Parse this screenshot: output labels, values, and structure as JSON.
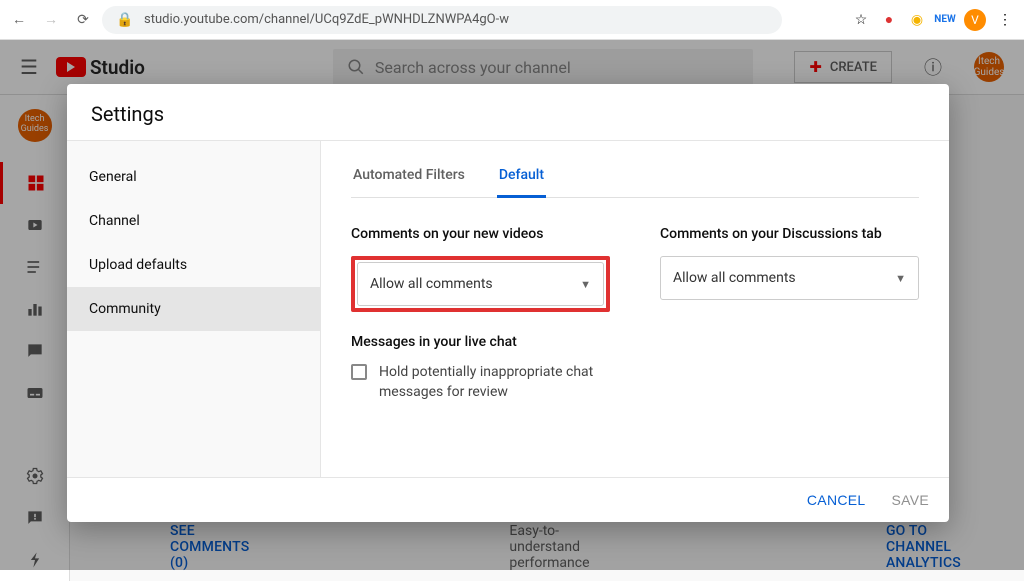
{
  "browser": {
    "url": "studio.youtube.com/channel/UCq9ZdE_pWNHDLZNWPA4gO-w",
    "avatar_letter": "V"
  },
  "studio_header": {
    "logo_text": "Studio",
    "search_placeholder": "Search across your channel",
    "create_label": "CREATE",
    "channel_initials": "Itech Guides"
  },
  "sidebar_channel_initials": "Itech Guides",
  "bg_links": {
    "see_comments": "SEE COMMENTS (0)",
    "go_analytics": "GO TO CHANNEL ANALYTICS",
    "easy_text": "Easy-to-understand performance"
  },
  "modal": {
    "title": "Settings",
    "nav": {
      "general": "General",
      "channel": "Channel",
      "upload_defaults": "Upload defaults",
      "community": "Community"
    },
    "tabs": {
      "automated": "Automated Filters",
      "default": "Default"
    },
    "left_col": {
      "heading": "Comments on your new videos",
      "selected": "Allow all comments",
      "sub_heading": "Messages in your live chat",
      "checkbox_label": "Hold potentially inappropriate chat messages for review"
    },
    "right_col": {
      "heading": "Comments on your Discussions tab",
      "selected": "Allow all comments"
    },
    "footer": {
      "cancel": "CANCEL",
      "save": "SAVE"
    }
  }
}
